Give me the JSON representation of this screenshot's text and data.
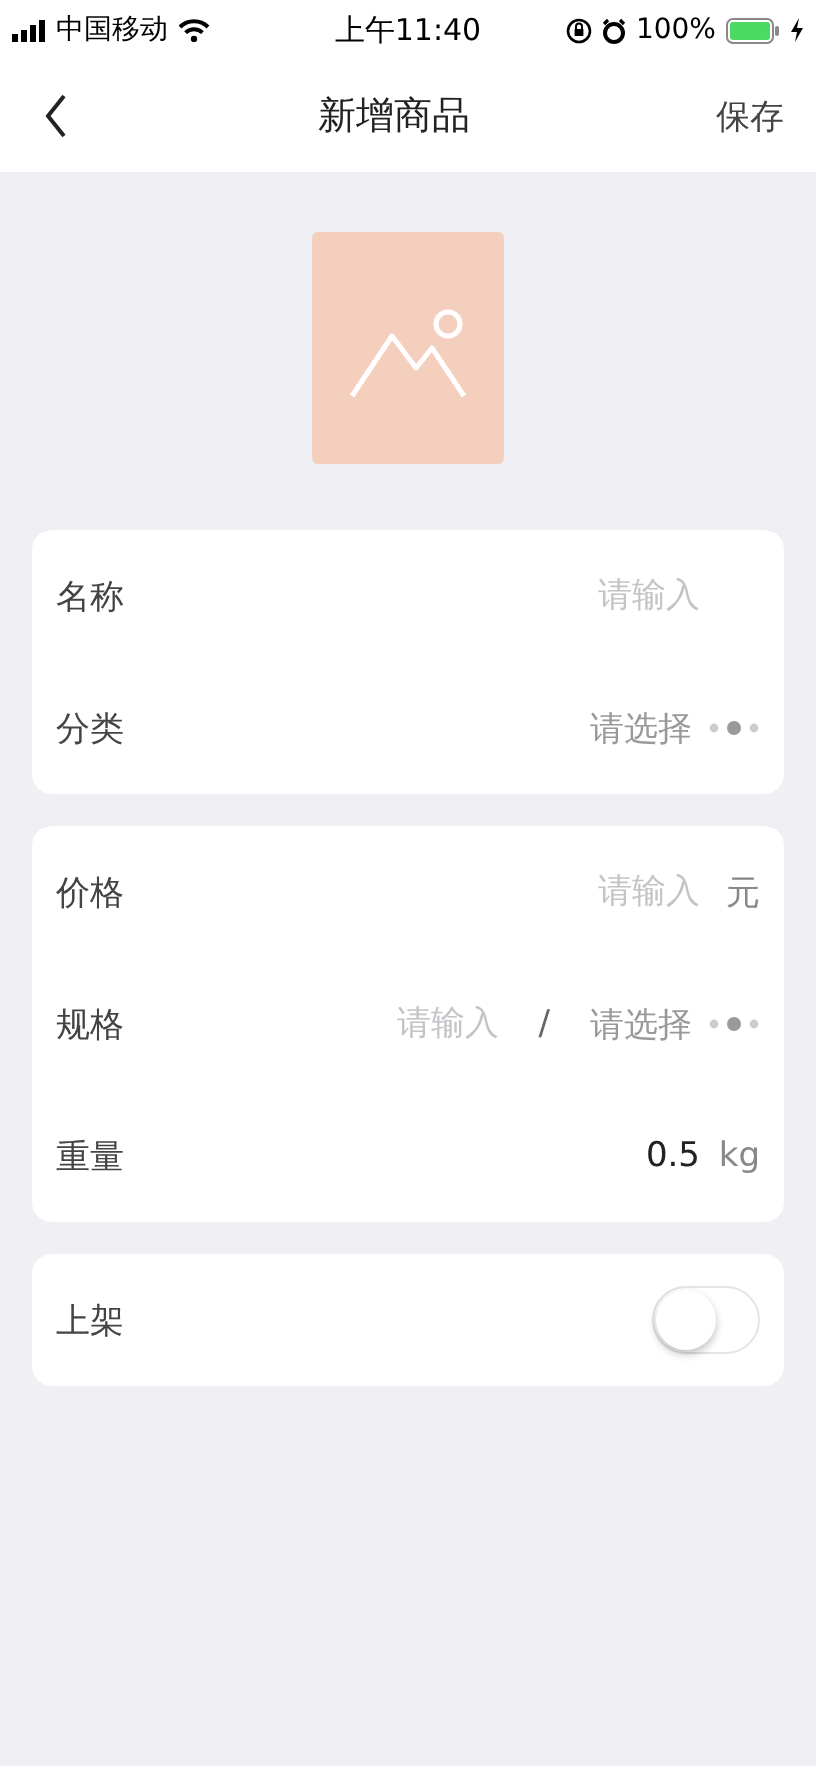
{
  "status_bar": {
    "carrier": "中国移动",
    "time": "上午11:40",
    "battery_text": "100%"
  },
  "nav": {
    "title": "新增商品",
    "action": "保存"
  },
  "groups": [
    {
      "rows": [
        {
          "kind": "input",
          "label": "名称",
          "placeholder": "请输入"
        },
        {
          "kind": "select",
          "label": "分类",
          "placeholder": "请选择"
        }
      ]
    },
    {
      "rows": [
        {
          "kind": "input",
          "label": "价格",
          "placeholder": "请输入",
          "unit": "元"
        },
        {
          "kind": "spec",
          "label": "规格",
          "placeholder": "请输入",
          "separator": "/",
          "select_placeholder": "请选择"
        },
        {
          "kind": "input",
          "label": "重量",
          "value": "0.5",
          "unit": "kg"
        }
      ]
    },
    {
      "rows": [
        {
          "kind": "switch",
          "label": "上架",
          "on": false
        }
      ]
    }
  ]
}
